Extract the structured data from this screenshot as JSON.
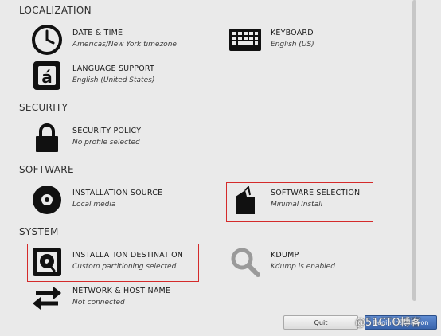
{
  "sections": {
    "localization": "LOCALIZATION",
    "security": "SECURITY",
    "software": "SOFTWARE",
    "system": "SYSTEM"
  },
  "spokes": {
    "datetime": {
      "label": "DATE & TIME",
      "status": "Americas/New York timezone",
      "icon": "clock-icon"
    },
    "keyboard": {
      "label": "KEYBOARD",
      "status": "English (US)",
      "icon": "keyboard-icon"
    },
    "language": {
      "label": "LANGUAGE SUPPORT",
      "status": "English (United States)",
      "icon": "language-icon"
    },
    "security_policy": {
      "label": "SECURITY POLICY",
      "status": "No profile selected",
      "icon": "lock-icon"
    },
    "install_source": {
      "label": "INSTALLATION SOURCE",
      "status": "Local media",
      "icon": "disc-icon"
    },
    "software_selection": {
      "label": "SOFTWARE SELECTION",
      "status": "Minimal Install",
      "icon": "package-icon"
    },
    "install_destination": {
      "label": "INSTALLATION DESTINATION",
      "status": "Custom partitioning selected",
      "icon": "harddisk-icon"
    },
    "kdump": {
      "label": "KDUMP",
      "status": "Kdump is enabled",
      "icon": "magnifier-icon"
    },
    "network": {
      "label": "NETWORK & HOST NAME",
      "status": "Not connected",
      "icon": "network-arrows-icon"
    }
  },
  "buttons": {
    "quit": "Quit",
    "begin": "Begin Installation"
  },
  "watermark": "@51CTO博客",
  "colors": {
    "highlight": "#d42a2a",
    "background": "#eaeaea",
    "primary_button": "#3a65ad"
  }
}
